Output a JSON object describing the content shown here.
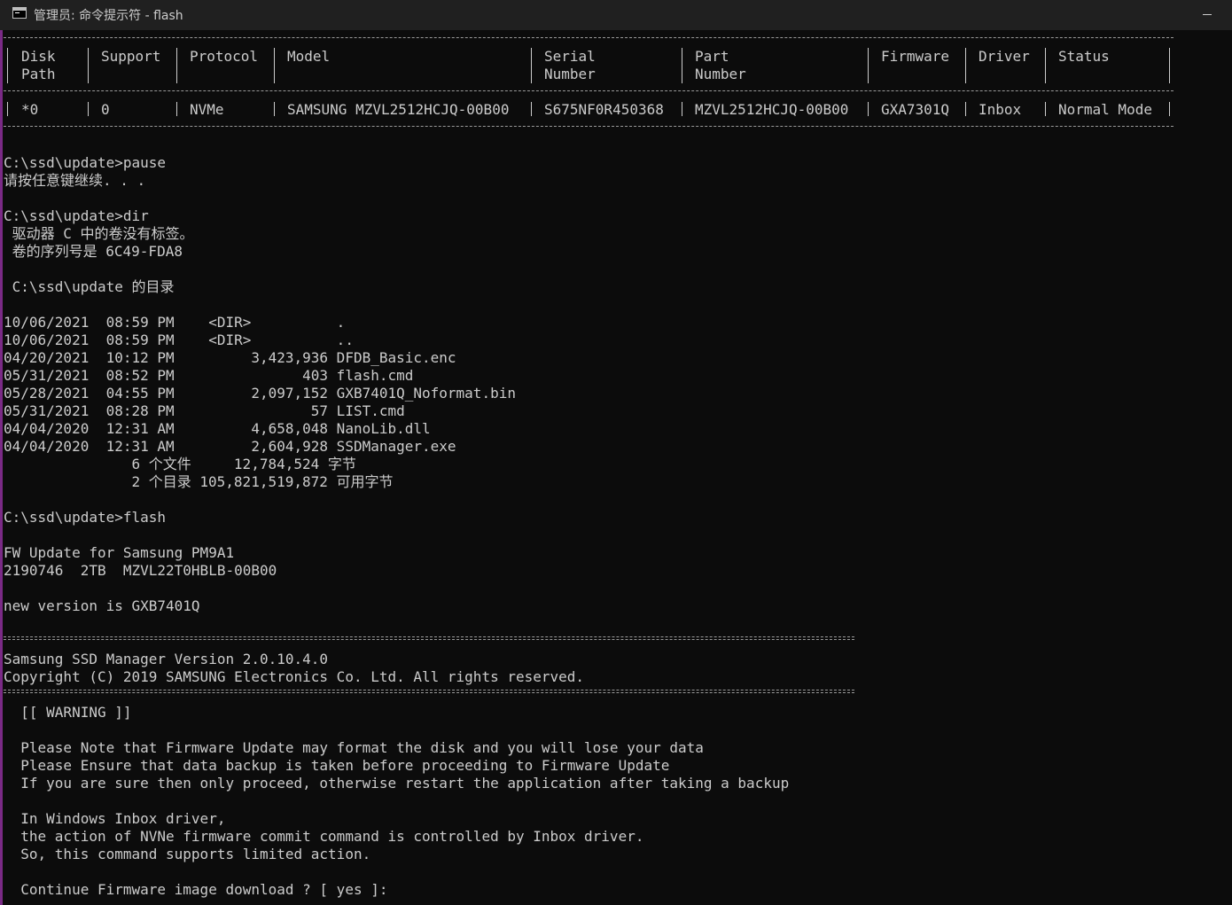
{
  "window": {
    "title": "管理员: 命令提示符 - flash",
    "icon": "console-icon",
    "minimize_icon": "minimize-icon"
  },
  "disk_table": {
    "headers": [
      {
        "line1": "Disk",
        "line2": "Path"
      },
      {
        "line1": "Support",
        "line2": ""
      },
      {
        "line1": "Protocol",
        "line2": ""
      },
      {
        "line1": "Model",
        "line2": ""
      },
      {
        "line1": "Serial",
        "line2": "Number"
      },
      {
        "line1": "Part",
        "line2": "Number"
      },
      {
        "line1": "Firmware",
        "line2": ""
      },
      {
        "line1": "Driver",
        "line2": ""
      },
      {
        "line1": "Status",
        "line2": ""
      }
    ],
    "row": [
      "*0",
      "0",
      "NVMe",
      "SAMSUNG MZVL2512HCJQ-00B00",
      "S675NF0R450368",
      "MZVL2512HCJQ-00B00",
      "GXA7301Q",
      "Inbox",
      "Normal Mode"
    ]
  },
  "console": {
    "pause_cmd": "C:\\ssd\\update>pause",
    "pause_msg": "请按任意键继续. . .",
    "dir_cmd": "C:\\ssd\\update>dir",
    "volume_label": " 驱动器 C 中的卷没有标签。",
    "volume_serial": " 卷的序列号是 6C49-FDA8",
    "dir_of": " C:\\ssd\\update 的目录",
    "files": [
      "10/06/2021  08:59 PM    <DIR>          .",
      "10/06/2021  08:59 PM    <DIR>          ..",
      "04/20/2021  10:12 PM         3,423,936 DFDB_Basic.enc",
      "05/31/2021  08:52 PM               403 flash.cmd",
      "05/28/2021  04:55 PM         2,097,152 GXB7401Q_Noformat.bin",
      "05/31/2021  08:28 PM                57 LIST.cmd",
      "04/04/2020  12:31 AM         4,658,048 NanoLib.dll",
      "04/04/2020  12:31 AM         2,604,928 SSDManager.exe"
    ],
    "file_summary": "               6 个文件     12,784,524 字节",
    "dir_summary": "               2 个目录 105,821,519,872 可用字节",
    "flash_cmd": "C:\\ssd\\update>flash",
    "fw_update": "FW Update for Samsung PM9A1",
    "fw_model": "2190746  2TB  MZVL22T0HBLB-00B00",
    "new_version": "new version is GXB7401Q",
    "manager_version": "Samsung SSD Manager Version 2.0.10.4.0",
    "copyright": "Copyright (C) 2019 SAMSUNG Electronics Co. Ltd. All rights reserved.",
    "warning_title": "  [[ WARNING ]]",
    "warning_lines": [
      "  Please Note that Firmware Update may format the disk and you will lose your data",
      "  Please Ensure that data backup is taken before proceeding to Firmware Update",
      "  If you are sure then only proceed, otherwise restart the application after taking a backup"
    ],
    "inbox_lines": [
      "  In Windows Inbox driver,",
      "  the action of NVNe firmware commit command is controlled by Inbox driver.",
      "  So, this command supports limited action."
    ],
    "prompt": "  Continue Firmware image download ? [ yes ]: "
  },
  "colors": {
    "background": "#0c0c0c",
    "text": "#cccccc",
    "titlebar": "#202020",
    "accent": "#7a2a86"
  }
}
